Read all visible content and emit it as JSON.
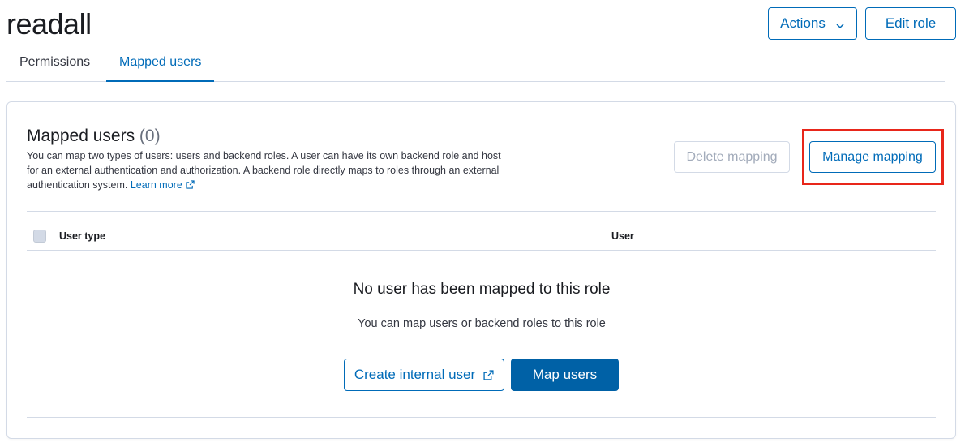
{
  "header": {
    "title": "readall",
    "actions_label": "Actions",
    "edit_role_label": "Edit role"
  },
  "tabs": [
    {
      "label": "Permissions",
      "active": false
    },
    {
      "label": "Mapped users",
      "active": true
    }
  ],
  "mapped_users": {
    "title": "Mapped users",
    "count": "(0)",
    "description": "You can map two types of users: users and backend roles. A user can have its own backend role and host for an external authentication and authorization. A backend role directly maps to roles through an external authentication system.",
    "learn_more": "Learn more",
    "delete_label": "Delete mapping",
    "manage_label": "Manage mapping"
  },
  "table": {
    "columns": [
      "User type",
      "User"
    ]
  },
  "empty_state": {
    "title": "No user has been mapped to this role",
    "subtitle": "You can map users or backend roles to this role",
    "create_label": "Create internal user",
    "map_label": "Map users"
  },
  "colors": {
    "primary": "#006bb8",
    "primary_fill": "#0061a6",
    "border": "#d3dae6",
    "highlight": "#e8261a"
  },
  "icons": {
    "actions": "chevron-down-icon",
    "learn_more": "external-link-icon",
    "create_user": "external-link-icon"
  }
}
